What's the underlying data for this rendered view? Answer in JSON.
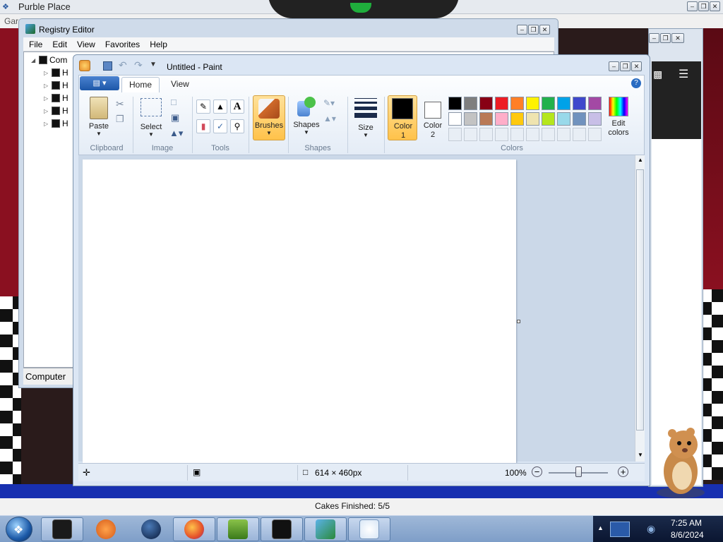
{
  "game": {
    "title": "Purble Place",
    "menu_partial": "Gar",
    "status": "Cakes Finished: 5/5"
  },
  "regedit": {
    "title": "Registry Editor",
    "menu": [
      "File",
      "Edit",
      "View",
      "Favorites",
      "Help"
    ],
    "tree_root": "Com",
    "tree_children": [
      "H",
      "H",
      "H",
      "H",
      "H"
    ],
    "status": "Computer"
  },
  "paint": {
    "title": "Untitled - Paint",
    "tabs": [
      "Home",
      "View"
    ],
    "groups": {
      "clipboard": {
        "label": "Clipboard",
        "paste": "Paste"
      },
      "image": {
        "label": "Image",
        "select": "Select"
      },
      "tools": {
        "label": "Tools"
      },
      "brushes": {
        "label": "Brushes"
      },
      "shapes": {
        "label": "Shapes",
        "shapes_btn": "Shapes"
      },
      "size": {
        "label": "Size"
      },
      "colors": {
        "label": "Colors",
        "color1": "Color 1",
        "color2": "Color 2",
        "edit_colors": "Edit colors"
      }
    },
    "palette_row1": [
      "#000000",
      "#7f7f7f",
      "#880015",
      "#ed1c24",
      "#ff7f27",
      "#fff200",
      "#22b14c",
      "#00a2e8",
      "#3f48cc",
      "#a349a4"
    ],
    "palette_row2": [
      "#ffffff",
      "#c3c3c3",
      "#b97a57",
      "#ffaec9",
      "#ffc90e",
      "#efe4b0",
      "#b5e61d",
      "#99d9ea",
      "#7092be",
      "#c8bfe7"
    ],
    "color1_value": "#000000",
    "color2_value": "#ffffff",
    "status": {
      "size": "614 × 460px",
      "zoom": "100%",
      "zoom_fraction": 0.5
    }
  },
  "taskbar": {
    "time": "7:25 AM",
    "date": "8/6/2024",
    "apps": [
      "paint-icon-dark",
      "media-player-icon",
      "globe-icon",
      "firefox-icon",
      "box-game-icon",
      "notepad-icon",
      "registry-icon",
      "paint-icon"
    ]
  }
}
